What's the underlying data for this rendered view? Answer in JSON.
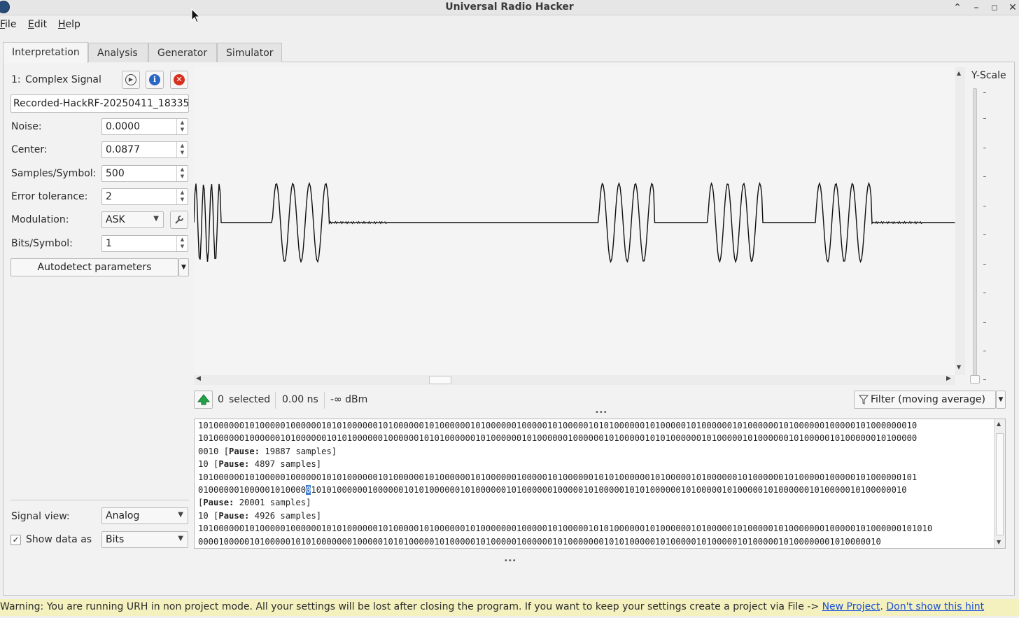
{
  "window": {
    "title": "Universal Radio Hacker"
  },
  "menu": [
    "File",
    "Edit",
    "Help"
  ],
  "tabs": [
    "Interpretation",
    "Analysis",
    "Generator",
    "Simulator"
  ],
  "signal": {
    "index_label": "1:",
    "name": "Complex Signal",
    "filename": "Recorded-HackRF-20250411_18335"
  },
  "params": {
    "noise_label": "Noise:",
    "noise": "0.0000",
    "center_label": "Center:",
    "center": "0.0877",
    "sps_label": "Samples/Symbol:",
    "sps": "500",
    "error_label": "Error tolerance:",
    "error": "2",
    "modulation_label": "Modulation:",
    "modulation": "ASK",
    "bits_label": "Bits/Symbol:",
    "bits": "1",
    "autodetect": "Autodetect parameters"
  },
  "view": {
    "signal_view_label": "Signal view:",
    "signal_view": "Analog",
    "show_data_label": "Show data as",
    "show_data": "Bits"
  },
  "yscale": {
    "label": "Y-Scale"
  },
  "status": {
    "selected": "0",
    "selected_label": "selected",
    "duration": "0.00 ns",
    "power": "-∞ dBm",
    "filter": "Filter (moving average)"
  },
  "data_lines": {
    "l1": "10100000010100000100000010101000000101000000101000000101000000100000101000001010100000010100000101000000101000000101000000100000101000000010",
    "l2": "10100000010000001010000001010100000010000001010100000010100000010100000010000001010000010101000000101000001010000001010000010100000010100000",
    "l3_bits": "0010",
    "l4_bits": "10",
    "l5": "10100000010100000100000010101000000101000000101000000101000000100000101000000101010000001010000010100000010100000010100000100000101000000101",
    "l6_pre": "010000001000001010000",
    "l6_sel": "0",
    "l6_post": "10101000000100000010101000000101000000101000000100000101000001010100000010100000101000001010000001010000010100000010",
    "l8_bits": "10",
    "l9": "10100000010100000100000010101000000101000001010000001010000000100000101000001010100000010100000010100000101000001010000000100000101000000101010",
    "l10": "0000100000101000001010100000001000001010100000101000001010000010000001010000000101010000010100000101000001010000010100000001010000010",
    "pause_label": "Pause:",
    "pause1": "19887 samples]",
    "pause2": "4897 samples]",
    "pause3": "20001 samples]",
    "pause4": "4926 samples]"
  },
  "hint": {
    "text": "Warning: You are running URH in non project mode. All your settings will be lost after closing the program. If you want to keep your settings create a project via File ->",
    "link1": "New Project",
    "link2": "Don't show this hint"
  },
  "colors": {
    "signal": "#111111",
    "selection": "#3a7bd5",
    "hint_bg": "#f4f1bf",
    "link": "#1a4fd8"
  }
}
